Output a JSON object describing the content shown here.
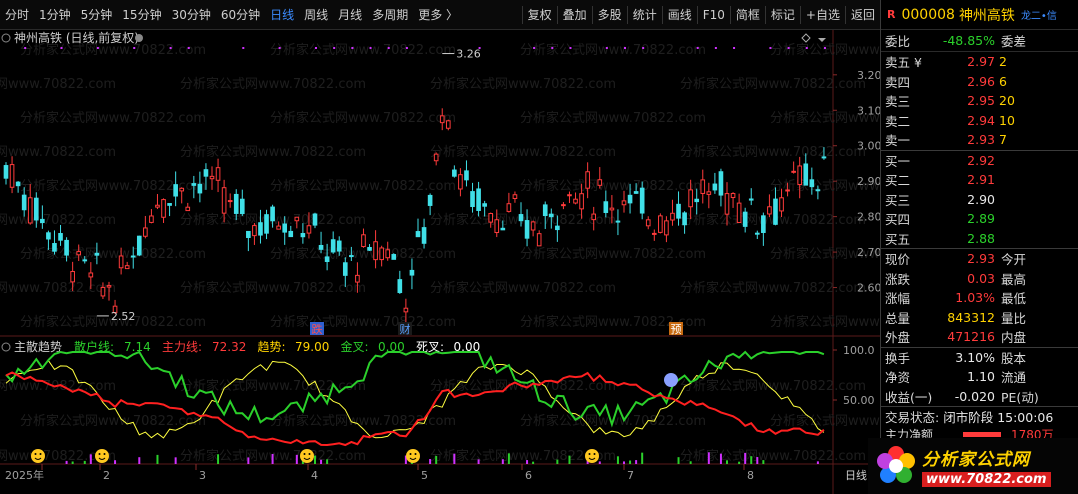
{
  "toolbar": {
    "periods": [
      "分时",
      "1分钟",
      "5分钟",
      "15分钟",
      "30分钟",
      "60分钟",
      "日线",
      "周线",
      "月线",
      "多周期",
      "更多 〉"
    ],
    "active_period": "日线",
    "actions": [
      "复权",
      "叠加",
      "多股",
      "统计",
      "画线",
      "F10",
      "简框",
      "标记",
      "+自选",
      "返回"
    ]
  },
  "main_chart": {
    "title": "神州高铁 (日线,前复权)",
    "watermark": "分析家公式网www.70822.com",
    "price_ticks": [
      "3.20",
      "3.10",
      "3.00",
      "2.90",
      "2.80",
      "2.70",
      "2.60"
    ],
    "high_label": "3.26",
    "low_label": "2.52",
    "event_markers": [
      "跌",
      "财",
      "预"
    ]
  },
  "indicator": {
    "name": "主散趋势",
    "items": [
      {
        "label": "散户线:",
        "value": "7.14",
        "color": "#2bd02b"
      },
      {
        "label": "主力线:",
        "value": "72.32",
        "color": "#ff3b3b"
      },
      {
        "label": "趋势:",
        "value": "79.00",
        "color": "#ffd200"
      },
      {
        "label": "金叉:",
        "value": "0.00",
        "color": "#2bd02b"
      },
      {
        "label": "死叉:",
        "value": "0.00",
        "color": "#ffffff"
      }
    ],
    "ticks": [
      "100.0",
      "50.00"
    ]
  },
  "x_axis": {
    "labels": [
      "2025年",
      "2",
      "3",
      "4",
      "5",
      "6",
      "7",
      "8"
    ],
    "tab": "日线"
  },
  "quote": {
    "r_mark": "R",
    "code": "000008",
    "name": "神州高铁",
    "tag": "龙二•信",
    "wb_label": "委比",
    "wb_value": "-48.85%",
    "wb_label2": "委差",
    "asks": [
      {
        "label": "卖五 ¥",
        "price": "2.97",
        "vol": "2"
      },
      {
        "label": "卖四",
        "price": "2.96",
        "vol": "6"
      },
      {
        "label": "卖三",
        "price": "2.95",
        "vol": "20"
      },
      {
        "label": "卖二",
        "price": "2.94",
        "vol": "10"
      },
      {
        "label": "卖一",
        "price": "2.93",
        "vol": "7"
      }
    ],
    "bids": [
      {
        "label": "买一",
        "price": "2.92",
        "vol": ""
      },
      {
        "label": "买二",
        "price": "2.91",
        "vol": ""
      },
      {
        "label": "买三",
        "price": "2.90",
        "vol": ""
      },
      {
        "label": "买四",
        "price": "2.89",
        "vol": ""
      },
      {
        "label": "买五",
        "price": "2.88",
        "vol": ""
      }
    ],
    "stats": [
      {
        "l1": "现价",
        "v1": "2.93",
        "c1": "red",
        "l2": "今开"
      },
      {
        "l1": "涨跌",
        "v1": "0.03",
        "c1": "red",
        "l2": "最高"
      },
      {
        "l1": "涨幅",
        "v1": "1.03%",
        "c1": "red",
        "l2": "最低"
      },
      {
        "l1": "总量",
        "v1": "843312",
        "c1": "yellow",
        "l2": "量比"
      },
      {
        "l1": "外盘",
        "v1": "471216",
        "c1": "red",
        "l2": "内盘"
      }
    ],
    "stats2": [
      {
        "l1": "换手",
        "v1": "3.10%",
        "l2": "股本"
      },
      {
        "l1": "净资",
        "v1": "1.10",
        "l2": "流通"
      },
      {
        "l1": "收益(一)",
        "v1": "-0.020",
        "l2": "PE(动)"
      }
    ],
    "status_label": "交易状态:",
    "status_value": "闭市阶段 15:00:06",
    "flow_label": "主力净额",
    "flow_value": "1780万"
  },
  "logo": {
    "text": "分析家公式网",
    "url": "www.70822.com"
  },
  "colors": {
    "up": "#ff3b3b",
    "down": "#40e0e8",
    "retail_line": "#2bd02b",
    "main_line": "#ff2020",
    "trend_line": "#ffff40",
    "purple_dots": "#d030ff"
  }
}
